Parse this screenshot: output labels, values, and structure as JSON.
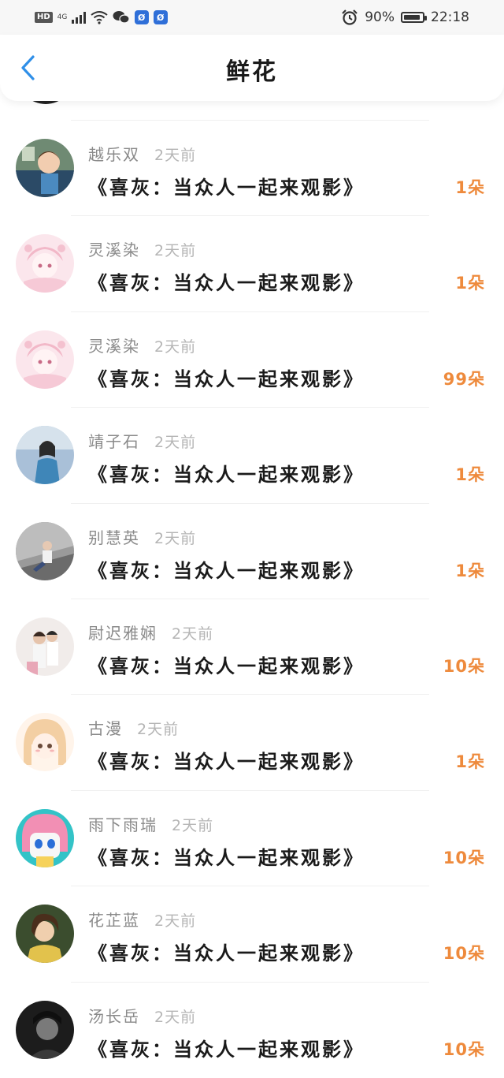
{
  "status_bar": {
    "hd": "HD",
    "network": "4G",
    "battery_text": "90%",
    "battery_level": 0.9,
    "time": "22:18",
    "badge": "Ø",
    "badge2": "Ø"
  },
  "header": {
    "title": "鲜花"
  },
  "colors": {
    "accent": "#2f8fe8",
    "count": "#ee8a3c",
    "name": "#8a8a8a"
  },
  "items": [
    {
      "name": "越乐双",
      "time": "2天前",
      "movie": "《喜灰：当众人一起来观影》",
      "count": "1朵",
      "avatar": "child-photo"
    },
    {
      "name": "灵溪染",
      "time": "2天前",
      "movie": "《喜灰：当众人一起来观影》",
      "count": "1朵",
      "avatar": "anime-pink"
    },
    {
      "name": "灵溪染",
      "time": "2天前",
      "movie": "《喜灰：当众人一起来观影》",
      "count": "99朵",
      "avatar": "anime-pink"
    },
    {
      "name": "靖子石",
      "time": "2天前",
      "movie": "《喜灰：当众人一起来观影》",
      "count": "1朵",
      "avatar": "woman-blue"
    },
    {
      "name": "别慧英",
      "time": "2天前",
      "movie": "《喜灰：当众人一起来观影》",
      "count": "1朵",
      "avatar": "man-sitting"
    },
    {
      "name": "尉迟雅娴",
      "time": "2天前",
      "movie": "《喜灰：当众人一起来观影》",
      "count": "10朵",
      "avatar": "couple"
    },
    {
      "name": "古漫",
      "time": "2天前",
      "movie": "《喜灰：当众人一起来观影》",
      "count": "1朵",
      "avatar": "anime-girl"
    },
    {
      "name": "雨下雨瑞",
      "time": "2天前",
      "movie": "《喜灰：当众人一起来观影》",
      "count": "10朵",
      "avatar": "cartoon-teal"
    },
    {
      "name": "花芷蓝",
      "time": "2天前",
      "movie": "《喜灰：当众人一起来观影》",
      "count": "10朵",
      "avatar": "woman-portrait"
    },
    {
      "name": "汤长岳",
      "time": "2天前",
      "movie": "《喜灰：当众人一起来观影》",
      "count": "10朵",
      "avatar": "dark-bw"
    }
  ]
}
